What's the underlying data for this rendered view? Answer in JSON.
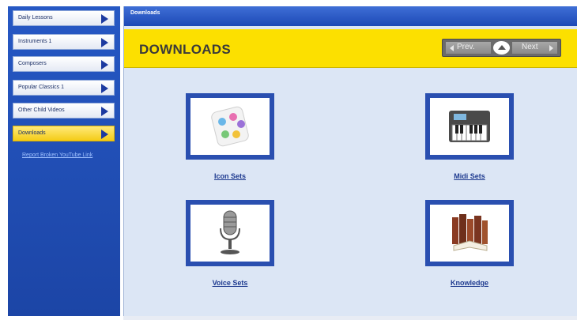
{
  "sidebar": {
    "items": [
      {
        "label": "Daily Lessons",
        "active": false
      },
      {
        "label": "Instruments 1",
        "active": false
      },
      {
        "label": "Composers",
        "active": false
      },
      {
        "label": "Popular Classics 1",
        "active": false
      },
      {
        "label": "Other Child Videos",
        "active": false
      },
      {
        "label": "Downloads",
        "active": true
      }
    ],
    "report_link": "Report Broken YouTube Link"
  },
  "window": {
    "title": "Downloads"
  },
  "header": {
    "title": "DOWNLOADS",
    "prev_label": "Prev.",
    "next_label": "Next"
  },
  "downloads": [
    {
      "label": "Icon Sets",
      "icon": "icon-palette-icon"
    },
    {
      "label": "Midi Sets",
      "icon": "piano-keyboard-icon"
    },
    {
      "label": "Voice Sets",
      "icon": "microphone-icon"
    },
    {
      "label": "Knowledge",
      "icon": "books-icon"
    }
  ],
  "colors": {
    "sidebar_blue": "#1f4fb8",
    "header_yellow": "#fce000",
    "panel_bg": "#dce6f5",
    "tile_border": "#2a4fb0",
    "link_blue": "#1e3a8f"
  }
}
